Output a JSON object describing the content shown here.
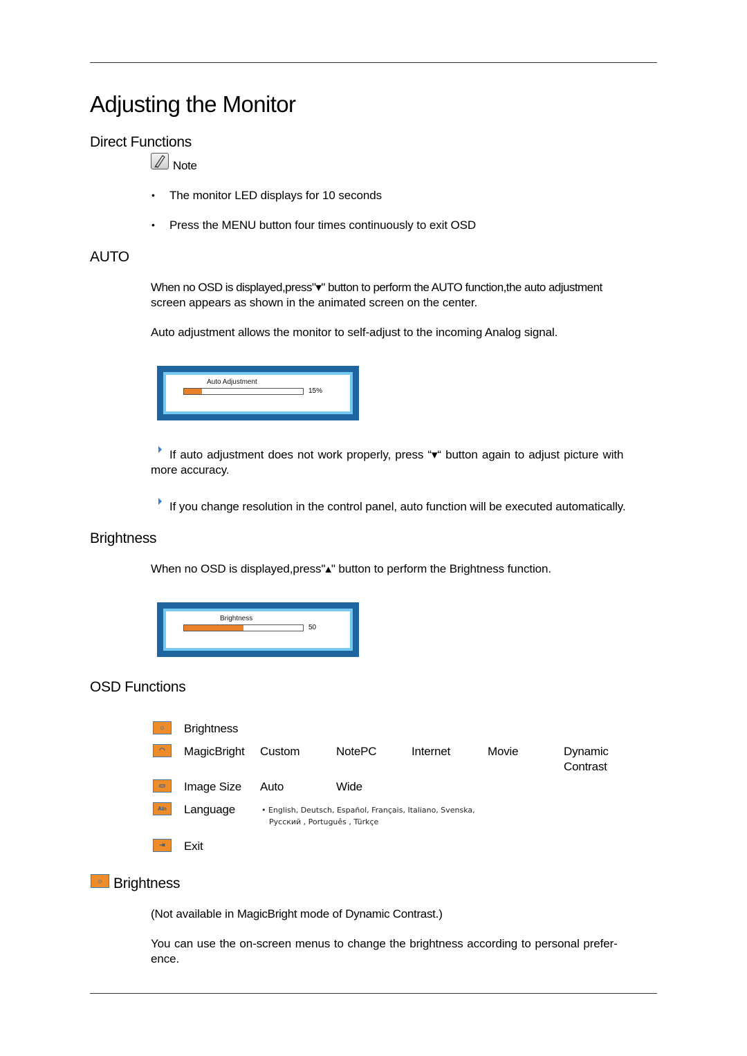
{
  "page": {
    "title": "Adjusting the Monitor"
  },
  "direct_functions": {
    "heading": "Direct Functions",
    "note_label": "Note",
    "note_icon": "note-pencil-icon",
    "bullets": [
      "The monitor LED displays for 10 seconds",
      "Press the MENU button four times continuously to exit OSD"
    ]
  },
  "auto": {
    "heading": "AUTO",
    "para1_line1": "When no OSD is displayed,press\"▾\" button to perform the AUTO function,the auto adjustment",
    "para1_line2": "screen appears as shown in the animated screen on the center.",
    "para2": "Auto adjustment allows the monitor to self-adjust to the incoming Analog signal.",
    "osd": {
      "label": "Auto Adjustment",
      "value_text": "15%",
      "progress_percent": 15
    },
    "tip1_line1": "If auto adjustment does not work properly, press “▾“ button again to adjust picture with",
    "tip1_line2": "more accuracy.",
    "tip2": "If you change resolution in the control panel, auto function will be executed automatically."
  },
  "brightness_direct": {
    "heading": "Brightness",
    "para": "When no OSD is displayed,press\"▴\" button to perform the Brightness function.",
    "osd": {
      "label": "Brightness",
      "value_text": "50",
      "progress_percent": 50
    }
  },
  "osd_functions": {
    "heading": "OSD Functions",
    "menu": [
      {
        "icon": "brightness-sun-icon",
        "name": "Brightness",
        "options": []
      },
      {
        "icon": "magicbright-icon",
        "name": "MagicBright",
        "options": [
          "Custom",
          "NotePC",
          "Internet",
          "Movie",
          "Dynamic Contrast"
        ]
      },
      {
        "icon": "image-size-icon",
        "name": "Image Size",
        "options": [
          "Auto",
          "Wide"
        ]
      },
      {
        "icon": "language-icon",
        "name": "Language",
        "options_line1": "• English, Deutsch, Español, Français,  Italiano, Svenska,",
        "options_line2": "Русский , Português , Türkçe"
      },
      {
        "icon": "exit-icon",
        "name": "Exit",
        "options": []
      }
    ],
    "magicbright_last_line1": "Dynamic",
    "magicbright_last_line2": "Contrast"
  },
  "brightness_section": {
    "heading": "Brightness",
    "icon": "brightness-sun-icon",
    "para1_prefix": "(Not available in ",
    "para1_bold1": "MagicBright",
    "para1_mid": " mode of ",
    "para1_bold2": "Dynamic Contrast",
    "para1_suffix": ".)",
    "para2_line1": "You can use the on-screen menus to change the brightness according to personal prefer-",
    "para2_line2": "ence."
  },
  "colors": {
    "osd_frame": "#1e65a0",
    "osd_inner": "#75c8ef",
    "progress_fill": "#e8812a",
    "menu_icon_bg": "#ef8c2a"
  }
}
